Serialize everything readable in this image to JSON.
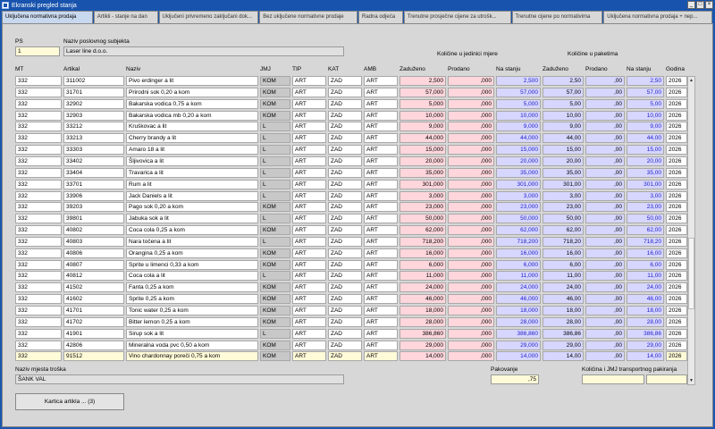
{
  "window": {
    "title": "Ekranski pregled stanja",
    "minimize": "_",
    "maximize": "□",
    "close": "×"
  },
  "tabs": [
    "Uključena normativna prodaja",
    "Artikli - stanje na dan",
    "Uključeni privremeno zaključani dok...",
    "Bez uključene normativne prodaje",
    "Radna odjeća",
    "Trenutne prosječne cijene za utrošk...",
    "Trenutne cijene po normativima",
    "Uključena normativna prodaja + nep..."
  ],
  "header": {
    "ps_label": "PS",
    "ps_value": "1",
    "subject_label": "Naziv poslovnog subjekta",
    "subject_value": "Laser line d.o.o.",
    "group_unit": "Količine u jedinici mjere",
    "group_pack": "Količine u paketima"
  },
  "columns": [
    "MT",
    "Artikal",
    "Naziv",
    "JMJ",
    "TIP",
    "KAT",
    "AMB",
    "Zaduženo",
    "Prodano",
    "Na stanju",
    "Zaduženo",
    "Prodano",
    "Na stanju",
    "Godina"
  ],
  "rows": [
    [
      "332",
      "311002",
      "Pivo erdinger a lit",
      "KOM",
      "ART",
      "ZAD",
      "ART",
      "2,500",
      ",000",
      "2,500",
      "2,50",
      ",00",
      "2,50",
      "2026"
    ],
    [
      "332",
      "31701",
      "Prirodni sok 0,20 a kom",
      "KOM",
      "ART",
      "ZAD",
      "ART",
      "57,000",
      ",000",
      "57,000",
      "57,00",
      ",00",
      "57,00",
      "2026"
    ],
    [
      "332",
      "32902",
      "Bakarska vodica 0,75 a kom",
      "KOM",
      "ART",
      "ZAD",
      "ART",
      "5,000",
      ",000",
      "5,000",
      "5,00",
      ",00",
      "5,00",
      "2026"
    ],
    [
      "332",
      "32903",
      "Bakarska vodica mb 0,20 a kom",
      "KOM",
      "ART",
      "ZAD",
      "ART",
      "10,000",
      ",000",
      "10,000",
      "10,00",
      ",00",
      "10,00",
      "2026"
    ],
    [
      "332",
      "33212",
      "Kruškovac a lit",
      "L",
      "ART",
      "ZAD",
      "ART",
      "9,000",
      ",000",
      "9,000",
      "9,00",
      ",00",
      "9,00",
      "2026"
    ],
    [
      "332",
      "33213",
      "Cherry brandy a lit",
      "L",
      "ART",
      "ZAD",
      "ART",
      "44,000",
      ",000",
      "44,000",
      "44,00",
      ",00",
      "44,00",
      "2026"
    ],
    [
      "332",
      "33303",
      "Amaro 18 a lit",
      "L",
      "ART",
      "ZAD",
      "ART",
      "15,000",
      ",000",
      "15,000",
      "15,00",
      ",00",
      "15,00",
      "2026"
    ],
    [
      "332",
      "33402",
      "Šljivovica a lit",
      "L",
      "ART",
      "ZAD",
      "ART",
      "20,000",
      ",000",
      "20,000",
      "20,00",
      ",00",
      "20,00",
      "2026"
    ],
    [
      "332",
      "33404",
      "Travarica a lit",
      "L",
      "ART",
      "ZAD",
      "ART",
      "35,000",
      ",000",
      "35,000",
      "35,00",
      ",00",
      "35,00",
      "2026"
    ],
    [
      "332",
      "33701",
      "Rum a lit",
      "L",
      "ART",
      "ZAD",
      "ART",
      "301,000",
      ",000",
      "301,000",
      "301,00",
      ",00",
      "301,00",
      "2026"
    ],
    [
      "332",
      "33906",
      "Jack Daniels a lit",
      "L",
      "ART",
      "ZAD",
      "ART",
      "3,000",
      ",000",
      "3,000",
      "3,00",
      ",00",
      "3,00",
      "2026"
    ],
    [
      "332",
      "39203",
      "Pago sok 0,20 a kom",
      "KOM",
      "ART",
      "ZAD",
      "ART",
      "23,000",
      ",000",
      "23,000",
      "23,00",
      ",00",
      "23,00",
      "2026"
    ],
    [
      "332",
      "39801",
      "Jabuka sok a lit",
      "L",
      "ART",
      "ZAD",
      "ART",
      "50,000",
      ",000",
      "50,000",
      "50,00",
      ",00",
      "50,00",
      "2026"
    ],
    [
      "332",
      "40802",
      "Coca cola 0,25 a kom",
      "KOM",
      "ART",
      "ZAD",
      "ART",
      "62,000",
      ",000",
      "62,000",
      "62,00",
      ",00",
      "62,00",
      "2026"
    ],
    [
      "332",
      "40803",
      "Nara točena a lit",
      "L",
      "ART",
      "ZAD",
      "ART",
      "718,200",
      ",000",
      "718,200",
      "718,20",
      ",00",
      "718,20",
      "2026"
    ],
    [
      "332",
      "40806",
      "Orangina 0,25 a kom",
      "KOM",
      "ART",
      "ZAD",
      "ART",
      "16,000",
      ",000",
      "16,000",
      "16,00",
      ",00",
      "16,00",
      "2026"
    ],
    [
      "332",
      "40807",
      "Sprite u limenci 0,33 a kom",
      "KOM",
      "ART",
      "ZAD",
      "ART",
      "6,000",
      ",000",
      "6,000",
      "6,00",
      ",00",
      "6,00",
      "2026"
    ],
    [
      "332",
      "40812",
      "Coca cola a lit",
      "L",
      "ART",
      "ZAD",
      "ART",
      "11,000",
      ",000",
      "11,000",
      "11,00",
      ",00",
      "11,00",
      "2026"
    ],
    [
      "332",
      "41502",
      "Fanta 0,25 a kom",
      "KOM",
      "ART",
      "ZAD",
      "ART",
      "24,000",
      ",000",
      "24,000",
      "24,00",
      ",00",
      "24,00",
      "2026"
    ],
    [
      "332",
      "41602",
      "Sprite 0,25 a kom",
      "KOM",
      "ART",
      "ZAD",
      "ART",
      "46,000",
      ",000",
      "46,000",
      "46,00",
      ",00",
      "46,00",
      "2026"
    ],
    [
      "332",
      "41701",
      "Tonic water 0,25 a kom",
      "KOM",
      "ART",
      "ZAD",
      "ART",
      "18,000",
      ",000",
      "18,000",
      "18,00",
      ",00",
      "18,00",
      "2026"
    ],
    [
      "332",
      "41702",
      "Bitter lemon 0,25 a kom",
      "KOM",
      "ART",
      "ZAD",
      "ART",
      "28,000",
      ",000",
      "28,000",
      "28,00",
      ",00",
      "28,00",
      "2026"
    ],
    [
      "332",
      "41901",
      "Sirup sok a lit",
      "L",
      "ART",
      "ZAD",
      "ART",
      "386,860",
      ",000",
      "386,860",
      "386,86",
      ",00",
      "386,86",
      "2026"
    ],
    [
      "332",
      "42806",
      "Mineralna voda pvc 0,50 a kom",
      "KOM",
      "ART",
      "ZAD",
      "ART",
      "29,000",
      ",000",
      "29,000",
      "29,00",
      ",00",
      "29,00",
      "2026"
    ],
    [
      "332",
      "91512",
      "Vino chardonnay poreči 0,75 a kom",
      "KOM",
      "ART",
      "ZAD",
      "ART",
      "14,000",
      ",000",
      "14,000",
      "14,00",
      ",00",
      "14,00",
      "2026"
    ]
  ],
  "footer": {
    "cost_label": "Naziv mjesta troška",
    "cost_value": "ŠANK VAL",
    "pack_label": "Pakovanje",
    "pack_value": ",75",
    "transport_label": "Količina i JMJ transportnog pakiranja",
    "transport_value": "",
    "button": "Kartica artikla ... (3)"
  },
  "scrollbar": {
    "up": "▲",
    "down": "▼"
  }
}
